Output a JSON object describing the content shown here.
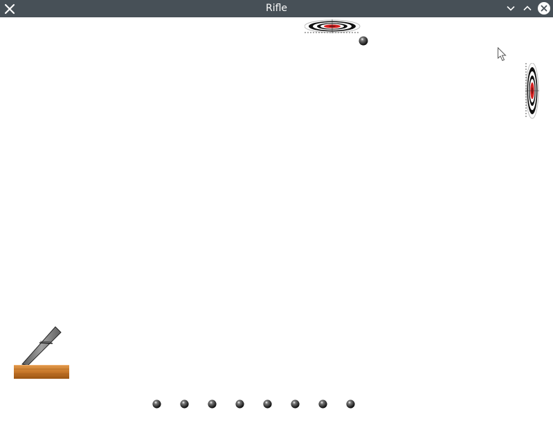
{
  "window": {
    "title": "Rifle"
  },
  "icons": {
    "app": "close-x-app-icon",
    "minimize": "chevron-down-icon",
    "maximize": "chevron-up-icon",
    "close": "close-circle-icon",
    "cursor": "mouse-pointer-icon"
  },
  "colors": {
    "titlebar_bg": "#475057",
    "titlebar_text": "#fcfcfc",
    "playfield_bg": "#ffffff",
    "target_red": "#d42020",
    "target_black": "#111111",
    "wood": "#c8782a",
    "barrel": "#8a8a8a"
  },
  "game": {
    "ammo_remaining": 8,
    "targets": [
      "target-top",
      "target-right"
    ],
    "projectiles_in_flight": 1
  }
}
